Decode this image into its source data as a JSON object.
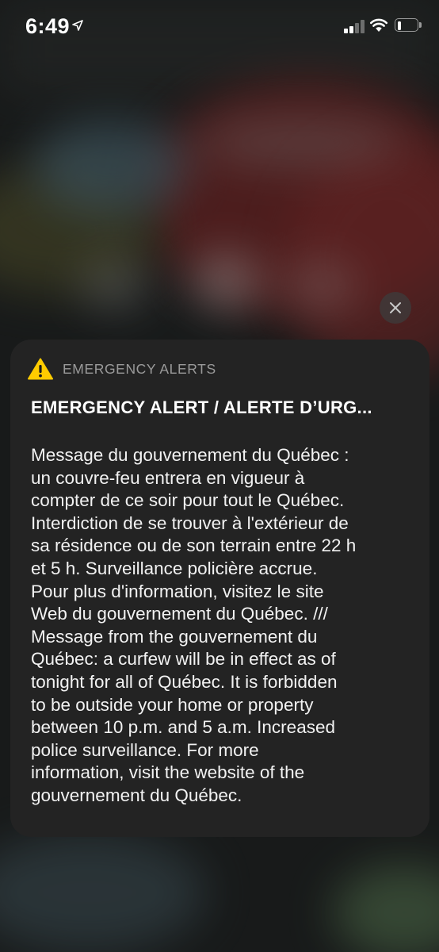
{
  "status_bar": {
    "time": "6:49",
    "icons": [
      "location-arrow-icon",
      "signal-icon",
      "wifi-icon",
      "battery-icon"
    ]
  },
  "alert_card": {
    "app_name": "EMERGENCY ALERTS",
    "app_icon": "warning-triangle-icon",
    "title": "EMERGENCY ALERT / ALERTE D’URG...",
    "body_lines": [
      "Message du gouvernement du Québec :",
      "un couvre-feu entrera en vigueur à",
      "compter de ce soir pour tout le Québec.",
      "Interdiction de se trouver à l'extérieur de",
      "sa résidence ou de son terrain entre 22 h",
      "et 5 h. Surveillance policière accrue.",
      "Pour plus d'information, visitez le site",
      "Web du gouvernement du Québec. ///",
      "Message from the gouvernement du",
      "Québec: a curfew will be in effect as of",
      "tonight for all of Québec. It is forbidden",
      "to be outside your home or property",
      "between 10 p.m. and 5 a.m. Increased",
      "police surveillance. For more",
      "information, visit the website of the",
      "gouvernement du Québec."
    ]
  },
  "close_button": {
    "icon": "close-icon"
  },
  "colors": {
    "card_background": "#232323",
    "warning_yellow": "#ffcc00",
    "secondary_text": "#9a9a9a"
  }
}
